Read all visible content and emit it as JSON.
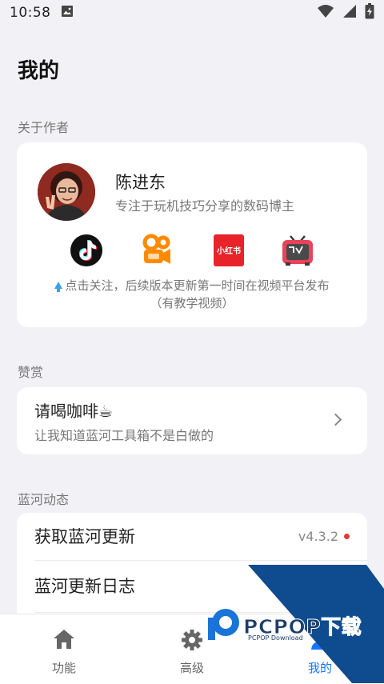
{
  "status_bar": {
    "time": "10:58"
  },
  "page_title": "我的",
  "about": {
    "section_label": "关于作者",
    "author_name": "陈进东",
    "author_desc": "专注于玩机技巧分享的数码博主",
    "platforms": [
      {
        "icon": "douyin-icon"
      },
      {
        "icon": "kuaishou-icon"
      },
      {
        "icon": "xiaohongshu-icon",
        "text": "小红书"
      },
      {
        "icon": "bilibili-icon"
      }
    ],
    "follow_text": "点击关注，后续版本更新第一时间在视频平台发布",
    "follow_text2": "（有教学视频）"
  },
  "reward": {
    "section_label": "赞赏",
    "title": "请喝咖啡☕",
    "subtitle": "让我知道蓝河工具箱不是白做的"
  },
  "updates": {
    "section_label": "蓝河动态",
    "rows": [
      {
        "label": "获取蓝河更新",
        "version": "v4.3.2"
      },
      {
        "label": "蓝河更新日志"
      }
    ]
  },
  "bottom_nav": {
    "items": [
      {
        "label": "功能",
        "icon": "home-icon"
      },
      {
        "label": "高级",
        "icon": "gear-icon"
      },
      {
        "label": "我的",
        "icon": "person-icon"
      }
    ]
  },
  "watermark": {
    "brand": "PCPOP下载",
    "sub": "PCPOP Download"
  },
  "colors": {
    "background": "#f2f2f6",
    "card": "#ffffff",
    "accent": "#1677ff",
    "badge_red": "#e53935",
    "watermark_blue": "#0f4c8f"
  }
}
